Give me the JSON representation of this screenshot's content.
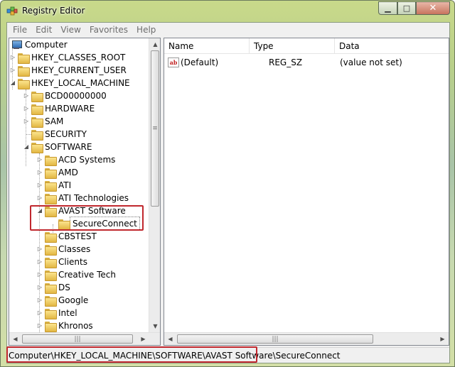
{
  "window": {
    "title": "Registry Editor",
    "caption_min": "0",
    "caption_max": "1",
    "caption_close": "r",
    "colors": {
      "highlight": "#c0282e",
      "folder": "#f3cf5e",
      "frame": "#b9d08a"
    }
  },
  "menu": [
    "File",
    "Edit",
    "View",
    "Favorites",
    "Help"
  ],
  "tree": {
    "root": "Computer",
    "hives": [
      "HKEY_CLASSES_ROOT",
      "HKEY_CURRENT_USER",
      "HKEY_LOCAL_MACHINE"
    ],
    "hklm_children": [
      "BCD00000000",
      "HARDWARE",
      "SAM",
      "SECURITY",
      "SOFTWARE"
    ],
    "software_children": [
      "ACD Systems",
      "AMD",
      "ATI",
      "ATI Technologies",
      "AVAST Software",
      "CBSTEST",
      "Classes",
      "Clients",
      "Creative Tech",
      "DS",
      "Google",
      "Intel",
      "Khronos"
    ],
    "avast_children": [
      "SecureConnect"
    ],
    "selected": "SecureConnect"
  },
  "list": {
    "columns": [
      "Name",
      "Type",
      "Data"
    ],
    "rows": [
      {
        "icon": "string-value-icon",
        "icon_text": "ab",
        "name": "(Default)",
        "type": "REG_SZ",
        "data": "(value not set)"
      }
    ]
  },
  "status_bar": {
    "path": "Computer\\HKEY_LOCAL_MACHINE\\SOFTWARE\\AVAST Software\\SecureConnect"
  }
}
